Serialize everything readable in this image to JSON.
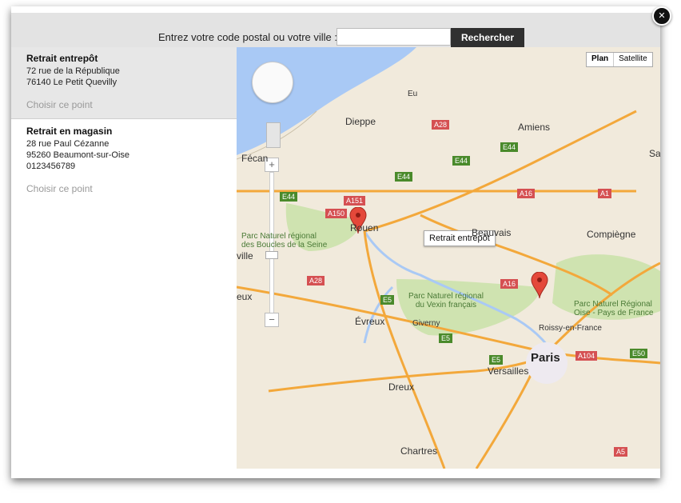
{
  "search": {
    "label": "Entrez votre code postal ou votre ville :",
    "value": "",
    "placeholder": "",
    "button_label": "Rechercher"
  },
  "close_glyph": "✕",
  "stores": [
    {
      "name": "Retrait entrepôt",
      "lines": [
        "72 rue de la République",
        "76140 Le Petit Quevilly"
      ],
      "action": "Choisir ce point"
    },
    {
      "name": "Retrait en magasin",
      "lines": [
        "28 rue Paul Cézanne",
        "95260 Beaumont-sur-Oise",
        "0123456789"
      ],
      "action": "Choisir ce point"
    }
  ],
  "map": {
    "tabs": [
      "Plan",
      "Satellite"
    ],
    "active_tab": "Plan",
    "zoom_plus": "+",
    "zoom_minus": "−",
    "tooltip": "Retrait entrepôt",
    "cities": {
      "dieppe": "Dieppe",
      "amiens": "Amiens",
      "fecamp": "Fécan",
      "rouen": "Rouen",
      "beauvais": "Beauvais",
      "compiegne": "Compiègne",
      "ville": "ville",
      "eux": "eux",
      "evreux": "Évreux",
      "giverny": "Giverny",
      "roissy": "Roissy-en-France",
      "paris": "Paris",
      "versailles": "Versailles",
      "dreux": "Dreux",
      "chartres": "Chartres",
      "eu": "Eu",
      "sa": "Sa"
    },
    "parks": {
      "seine": "Parc Naturel régional\ndes Boucles de la Seine",
      "vexin": "Parc Naturel régional\ndu Vexin français",
      "oise": "Parc Naturel Régional\nOise - Pays de France"
    },
    "roads": {
      "a28_n": "A28",
      "e44_a": "E44",
      "e44_b": "E44",
      "e44_c": "E44",
      "e44_d": "E44",
      "a151": "A151",
      "a150": "A150",
      "a16_n": "A16",
      "a1": "A1",
      "a28_s": "A28",
      "a16_s": "A16",
      "e5_a": "E5",
      "e5_b": "E5",
      "e5_c": "E5",
      "a104": "A104",
      "e50": "E50",
      "a5": "A5"
    }
  }
}
